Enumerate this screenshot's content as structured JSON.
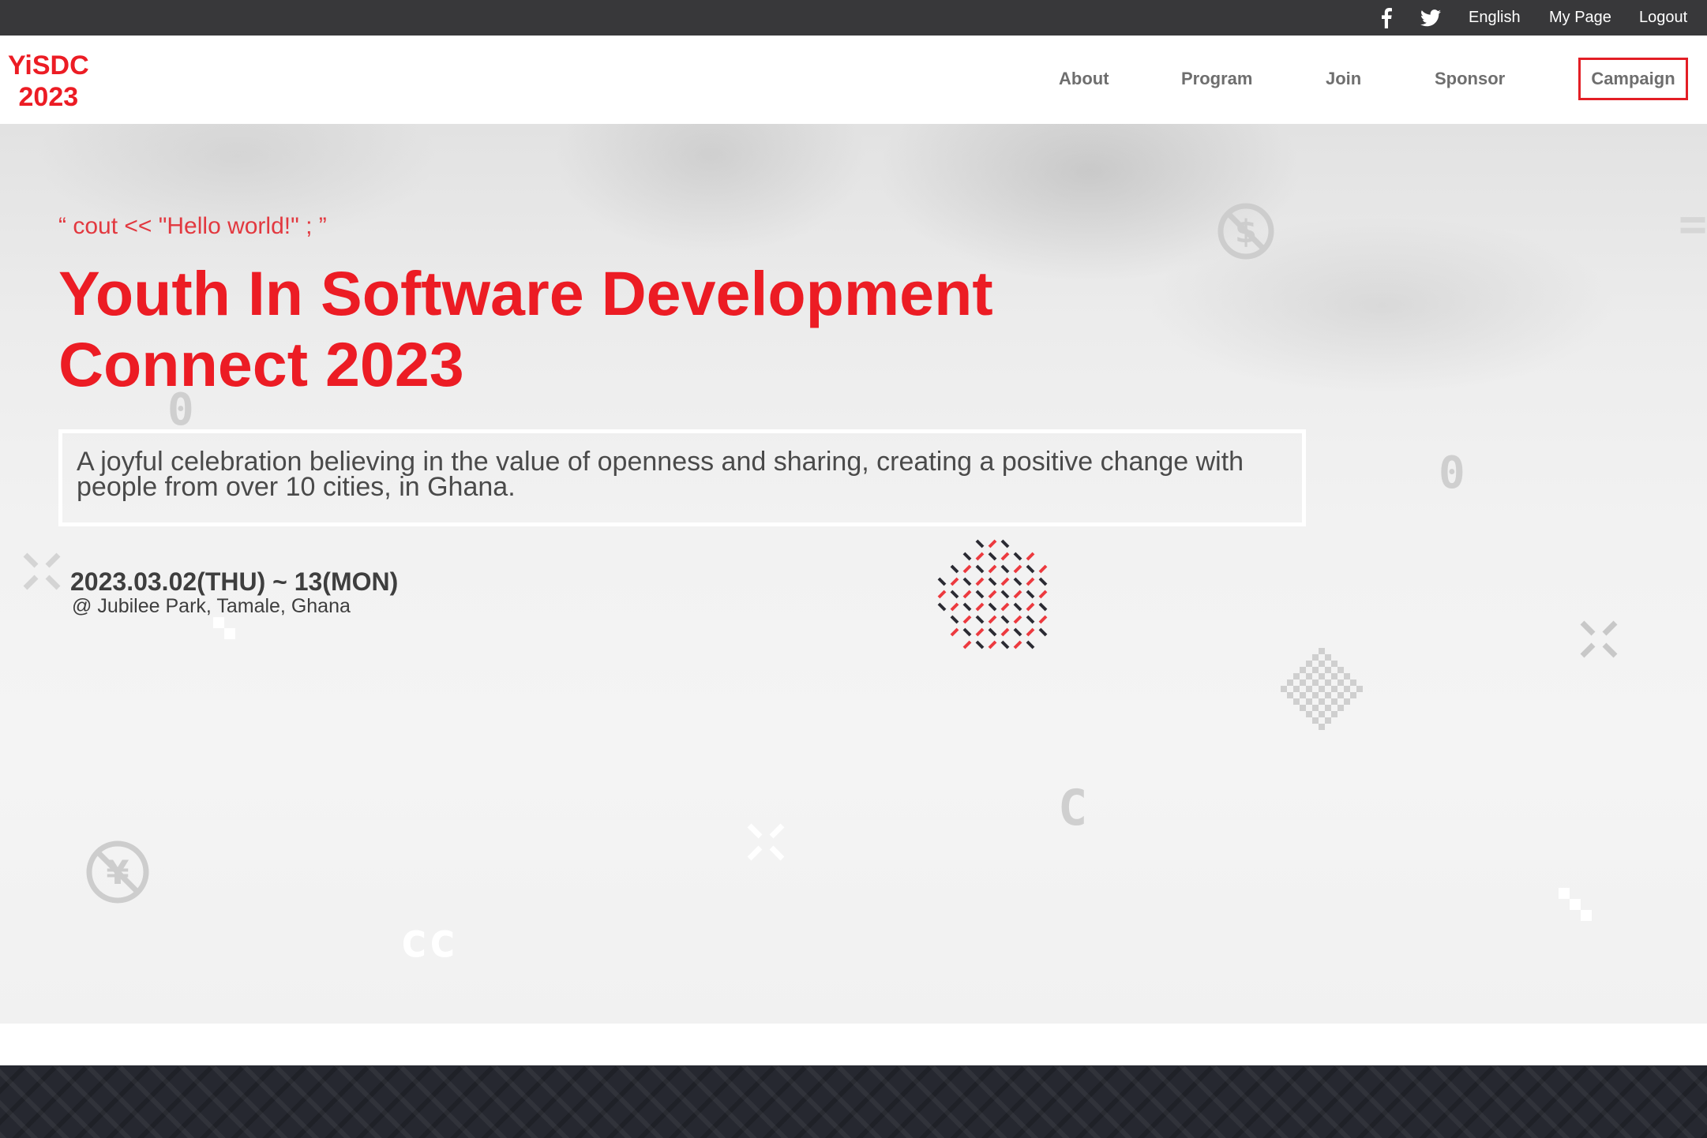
{
  "utility_bar": {
    "facebook_icon": "facebook-icon",
    "twitter_icon": "twitter-icon",
    "language": "English",
    "my_page": "My Page",
    "logout": "Logout"
  },
  "header": {
    "logo_line1": "YiSDC",
    "logo_line2": "2023",
    "nav": {
      "about": "About",
      "program": "Program",
      "join": "Join",
      "sponsor": "Sponsor",
      "campaign": "Campaign"
    }
  },
  "hero": {
    "tagline": "“ cout << \"Hello world!\" ; ”",
    "title_line1": "Youth In Software Development",
    "title_line2": "Connect 2023",
    "description": "A joyful celebration believing in the value of openness and sharing, creating a positive change with people from over 10 cities, in Ghana.",
    "date": "2023.03.02(THU) ~ 13(MON)",
    "location": "@ Jubilee Park, Tamale, Ghana"
  },
  "colors": {
    "brand_red": "#ec1c24",
    "utility_bar_bg": "#38383a",
    "footer_bg": "#262830",
    "nav_text": "#6e6e6e"
  }
}
